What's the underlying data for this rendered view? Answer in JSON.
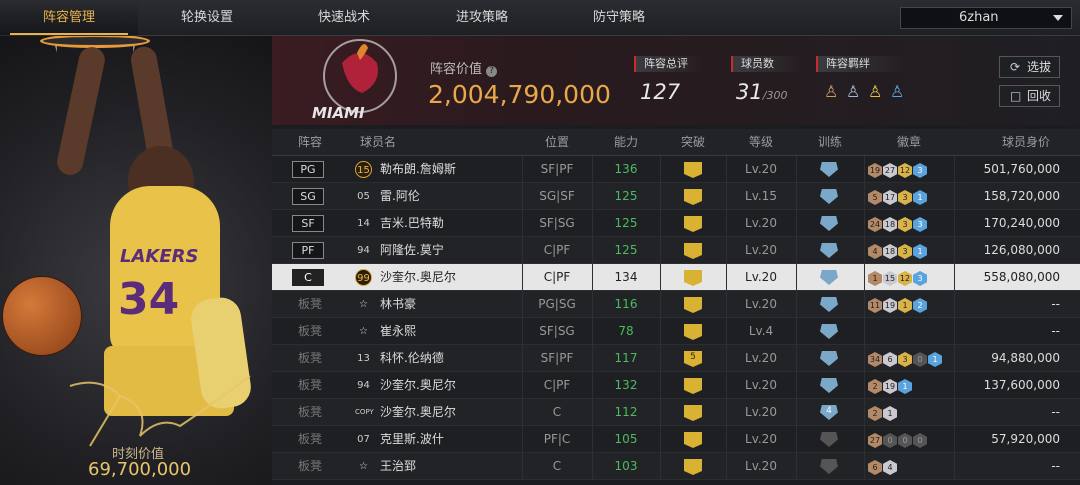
{
  "nav": {
    "tabs": [
      {
        "label": "阵容管理",
        "active": true
      },
      {
        "label": "轮换设置",
        "active": false
      },
      {
        "label": "快速战术",
        "active": false
      },
      {
        "label": "进攻策略",
        "active": false
      },
      {
        "label": "防守策略",
        "active": false
      }
    ],
    "dropdown_value": "6zhan"
  },
  "feature_player": {
    "jersey_text": "LAKERS",
    "jersey_number": "34",
    "moment_label": "时刻价值",
    "moment_value": "69,700,000"
  },
  "header": {
    "team_logo_text": "MIAMI",
    "value_label": "阵容价值",
    "value": "2,004,790,000",
    "overall_label": "阵容总评",
    "overall": "127",
    "players_label": "球员数",
    "players_count": "31",
    "players_max": "/300",
    "bond_label": "阵容羁绊",
    "bond_icons": [
      "bond-icon-1",
      "bond-icon-2",
      "bond-icon-3",
      "bond-icon-4"
    ],
    "btn_pick": "选拔",
    "btn_recycle": "回收"
  },
  "columns": [
    "阵容",
    "球员名",
    "位置",
    "能力",
    "突破",
    "等级",
    "训练",
    "徽章",
    "球员身价"
  ],
  "rows": [
    {
      "slot": "PG",
      "bench": false,
      "num": "15",
      "num_style": "gold",
      "name": "勒布朗.詹姆斯",
      "position": "SF|PF",
      "ability": "136",
      "ability_green": true,
      "break": "",
      "level": "Lv.20",
      "train": "",
      "badges": [
        [
          "19",
          "br"
        ],
        [
          "27",
          "si"
        ],
        [
          "12",
          "go"
        ],
        [
          "3",
          "bl"
        ]
      ],
      "price": "501,760,000"
    },
    {
      "slot": "SG",
      "bench": false,
      "num": "05",
      "num_style": "",
      "name": "雷.阿伦",
      "position": "SG|SF",
      "ability": "125",
      "ability_green": true,
      "break": "",
      "level": "Lv.15",
      "train": "",
      "badges": [
        [
          "5",
          "br"
        ],
        [
          "17",
          "si"
        ],
        [
          "3",
          "go"
        ],
        [
          "1",
          "bl"
        ]
      ],
      "price": "158,720,000"
    },
    {
      "slot": "SF",
      "bench": false,
      "num": "14",
      "num_style": "",
      "name": "吉米.巴特勒",
      "position": "SF|SG",
      "ability": "125",
      "ability_green": true,
      "break": "",
      "level": "Lv.20",
      "train": "",
      "badges": [
        [
          "24",
          "br"
        ],
        [
          "18",
          "si"
        ],
        [
          "3",
          "go"
        ],
        [
          "3",
          "bl"
        ]
      ],
      "price": "170,240,000"
    },
    {
      "slot": "PF",
      "bench": false,
      "num": "94",
      "num_style": "",
      "name": "阿隆佐.莫宁",
      "position": "C|PF",
      "ability": "125",
      "ability_green": true,
      "break": "",
      "level": "Lv.20",
      "train": "",
      "badges": [
        [
          "4",
          "br"
        ],
        [
          "18",
          "si"
        ],
        [
          "3",
          "go"
        ],
        [
          "1",
          "bl"
        ]
      ],
      "price": "126,080,000"
    },
    {
      "slot": "C",
      "bench": false,
      "selected": true,
      "num": "99",
      "num_style": "gold",
      "name": "沙奎尔.奥尼尔",
      "position": "C|PF",
      "ability": "134",
      "ability_green": false,
      "break": "",
      "level": "Lv.20",
      "train": "",
      "badges": [
        [
          "1",
          "br"
        ],
        [
          "15",
          "si"
        ],
        [
          "12",
          "go"
        ],
        [
          "3",
          "bl"
        ]
      ],
      "price": "558,080,000"
    },
    {
      "slot": "板凳",
      "bench": true,
      "num": "☆",
      "num_style": "star",
      "name": "林书豪",
      "position": "PG|SG",
      "ability": "116",
      "ability_green": true,
      "break": "",
      "level": "Lv.20",
      "train": "",
      "badges": [
        [
          "11",
          "br"
        ],
        [
          "19",
          "si"
        ],
        [
          "1",
          "go"
        ],
        [
          "2",
          "bl"
        ]
      ],
      "price": "--"
    },
    {
      "slot": "板凳",
      "bench": true,
      "num": "☆",
      "num_style": "star",
      "name": "崔永熙",
      "position": "SF|SG",
      "ability": "78",
      "ability_green": true,
      "break": "",
      "level": "Lv.4",
      "train": "",
      "badges": [],
      "price": "--"
    },
    {
      "slot": "板凳",
      "bench": true,
      "num": "13",
      "num_style": "",
      "name": "科怀.伦纳德",
      "position": "SF|PF",
      "ability": "117",
      "ability_green": true,
      "break": "5",
      "level": "Lv.20",
      "train": "",
      "badges": [
        [
          "34",
          "br"
        ],
        [
          "6",
          "si"
        ],
        [
          "3",
          "go"
        ],
        [
          "0",
          "dk"
        ],
        [
          "1",
          "bl"
        ]
      ],
      "price": "94,880,000"
    },
    {
      "slot": "板凳",
      "bench": true,
      "num": "94",
      "num_style": "",
      "name": "沙奎尔.奥尼尔",
      "position": "C|PF",
      "ability": "132",
      "ability_green": true,
      "break": "",
      "level": "Lv.20",
      "train": "",
      "badges": [
        [
          "2",
          "br"
        ],
        [
          "19",
          "si"
        ],
        [
          "1",
          "bl"
        ]
      ],
      "price": "137,600,000"
    },
    {
      "slot": "板凳",
      "bench": true,
      "num": "COPY",
      "num_style": "",
      "name": "沙奎尔.奥尼尔",
      "position": "C",
      "ability": "112",
      "ability_green": true,
      "break": "",
      "level": "Lv.20",
      "train": "4",
      "badges": [
        [
          "2",
          "br"
        ],
        [
          "1",
          "si"
        ]
      ],
      "price": "--"
    },
    {
      "slot": "板凳",
      "bench": true,
      "num": "07",
      "num_style": "",
      "name": "克里斯.波什",
      "position": "PF|C",
      "ability": "105",
      "ability_green": true,
      "break": "",
      "level": "Lv.20",
      "train": "",
      "train_grey": true,
      "badges": [
        [
          "27",
          "br"
        ],
        [
          "0",
          "dk"
        ],
        [
          "0",
          "dk"
        ],
        [
          "0",
          "dk"
        ]
      ],
      "price": "57,920,000"
    },
    {
      "slot": "板凳",
      "bench": true,
      "num": "☆",
      "num_style": "star",
      "name": "王治郅",
      "position": "C",
      "ability": "103",
      "ability_green": true,
      "break": "",
      "level": "Lv.20",
      "train": "",
      "train_grey": true,
      "badges": [
        [
          "6",
          "br"
        ],
        [
          "4",
          "si"
        ]
      ],
      "price": "--"
    }
  ]
}
